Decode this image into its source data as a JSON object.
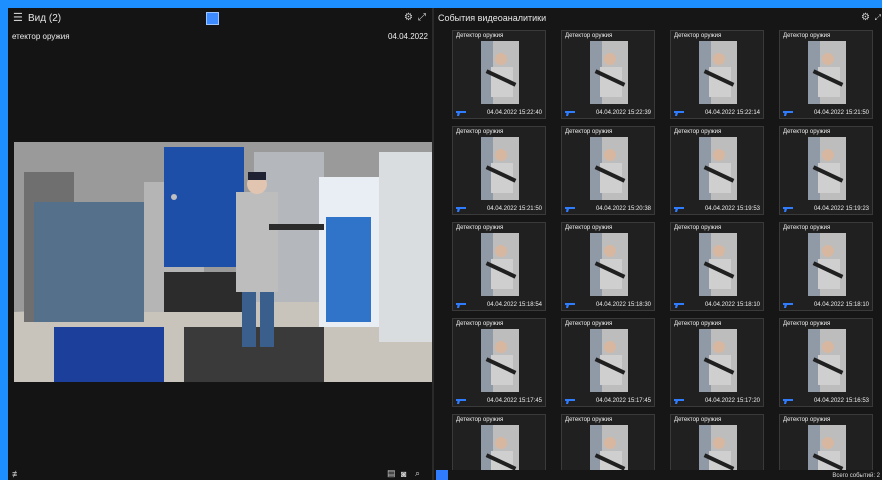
{
  "left": {
    "title": "Вид (2)",
    "camera_title": "етектор оружия",
    "camera_date": "04.04.2022",
    "icons": [
      "menu-icon",
      "gear-icon",
      "expand-icon",
      "settings-sliders-icon",
      "layout-icon",
      "camera-icon",
      "search-icon"
    ]
  },
  "right": {
    "title": "События видеоаналитики",
    "footer_total": "Всего событий: 2",
    "cards": [
      {
        "title": "Детектор оружия",
        "date": "04.04.2022 15:22:40"
      },
      {
        "title": "Детектор оружия",
        "date": "04.04.2022 15:22:39"
      },
      {
        "title": "Детектор оружия",
        "date": "04.04.2022 15:22:14"
      },
      {
        "title": "Детектор оружия",
        "date": "04.04.2022 15:21:50"
      },
      {
        "title": "Детектор оружия",
        "date": "04.04.2022 15:21:50"
      },
      {
        "title": "Детектор оружия",
        "date": "04.04.2022 15:20:38"
      },
      {
        "title": "Детектор оружия",
        "date": "04.04.2022 15:19:53"
      },
      {
        "title": "Детектор оружия",
        "date": "04.04.2022 15:19:23"
      },
      {
        "title": "Детектор оружия",
        "date": "04.04.2022 15:18:54"
      },
      {
        "title": "Детектор оружия",
        "date": "04.04.2022 15:18:30"
      },
      {
        "title": "Детектор оружия",
        "date": "04.04.2022 15:18:10"
      },
      {
        "title": "Детектор оружия",
        "date": "04.04.2022 15:18:10"
      },
      {
        "title": "Детектор оружия",
        "date": "04.04.2022 15:17:45"
      },
      {
        "title": "Детектор оружия",
        "date": "04.04.2022 15:17:45"
      },
      {
        "title": "Детектор оружия",
        "date": "04.04.2022 15:17:20"
      },
      {
        "title": "Детектор оружия",
        "date": "04.04.2022 15:16:53"
      },
      {
        "title": "Детектор оружия",
        "date": ""
      },
      {
        "title": "Детектор оружия",
        "date": ""
      },
      {
        "title": "Детектор оружия",
        "date": ""
      },
      {
        "title": "Детектор оружия",
        "date": ""
      }
    ]
  },
  "colors": {
    "accent": "#2f7cff",
    "frame": "#1e8fff"
  }
}
